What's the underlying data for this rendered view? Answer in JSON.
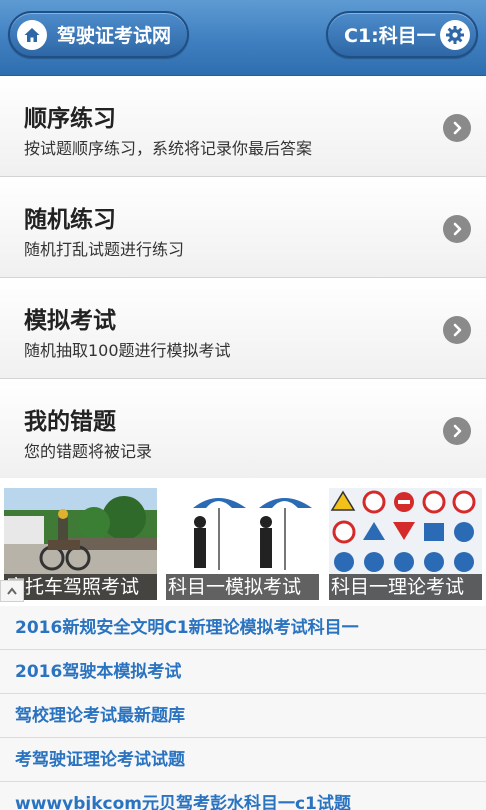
{
  "header": {
    "home_label": "驾驶证考试网",
    "level_label": "C1:科目一"
  },
  "menu": [
    {
      "title": "顺序练习",
      "subtitle": "按试题顺序练习，系统将记录你最后答案"
    },
    {
      "title": "随机练习",
      "subtitle": "随机打乱试题进行练习"
    },
    {
      "title": "模拟考试",
      "subtitle": "随机抽取100题进行模拟考试"
    },
    {
      "title": "我的错题",
      "subtitle": "您的错题将被记录"
    }
  ],
  "banner": [
    {
      "caption": "摩托车驾照考试"
    },
    {
      "caption": "科目一模拟考试"
    },
    {
      "caption": "科目一理论考试"
    }
  ],
  "links": [
    "2016新规安全文明C1新理论模拟考试科目一",
    "2016驾驶本模拟考试",
    "驾校理论考试最新题库",
    "考驾驶证理论考试试题",
    "wwwybjkcom元贝驾考彭水科目一c1试题"
  ],
  "icons": {
    "home": "home-icon",
    "settings": "gear-icon",
    "arrow": "chevron-right-icon"
  },
  "colors": {
    "header": "#3f7fc0",
    "link": "#2a73c0"
  }
}
